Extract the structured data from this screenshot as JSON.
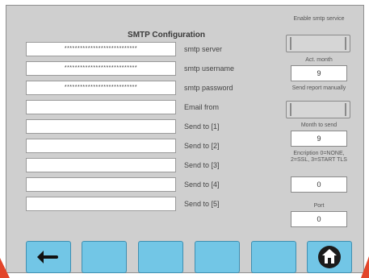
{
  "title": "SMTP Configuration",
  "fields": [
    {
      "label": "smtp server",
      "value": "****************************"
    },
    {
      "label": "smtp username",
      "value": "****************************"
    },
    {
      "label": "smtp password",
      "value": "****************************"
    },
    {
      "label": "Email from",
      "value": ""
    },
    {
      "label": "Send to [1]",
      "value": ""
    },
    {
      "label": "Send to [2]",
      "value": ""
    },
    {
      "label": "Send to [3]",
      "value": ""
    },
    {
      "label": "Send to [4]",
      "value": ""
    },
    {
      "label": "Send to [5]",
      "value": ""
    }
  ],
  "right": {
    "enable_smtp_label": "Enable smtp service",
    "act_month_label": "Act. month",
    "act_month_value": "9",
    "send_report_label": "Send report manually",
    "month_to_send_label": "Month to send",
    "month_to_send_value": "9",
    "encryption_label": "Encription 0=NONE, 2=SSL, 3=START TLS",
    "encryption_value": "0",
    "port_label": "Port",
    "port_value": "0"
  },
  "colors": {
    "button_fill": "#72c6e6",
    "home_icon_fill": "#1b1b1b",
    "accent_corner": "#e2452a"
  }
}
